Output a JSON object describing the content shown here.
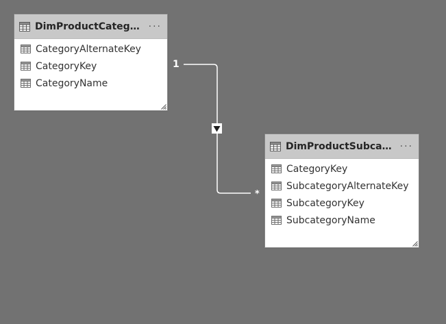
{
  "tables": [
    {
      "id": "dim-product-category",
      "title": "DimProductCategory",
      "more_label": "···",
      "fields": [
        "CategoryAlternateKey",
        "CategoryKey",
        "CategoryName"
      ]
    },
    {
      "id": "dim-product-subcategory",
      "title": "DimProductSubcate...",
      "more_label": "···",
      "fields": [
        "CategoryKey",
        "SubcategoryAlternateKey",
        "SubcategoryKey",
        "SubcategoryName"
      ]
    }
  ],
  "relationship": {
    "from_cardinality": "1",
    "to_cardinality": "*",
    "filter_direction": "down"
  },
  "colors": {
    "canvas": "#727272",
    "header": "#c8c8c8",
    "card": "#ffffff",
    "line": "#ffffff"
  },
  "icons": [
    "table-icon",
    "field-icon",
    "more-options-icon",
    "resize-handle-icon",
    "filter-direction-arrow-icon"
  ]
}
